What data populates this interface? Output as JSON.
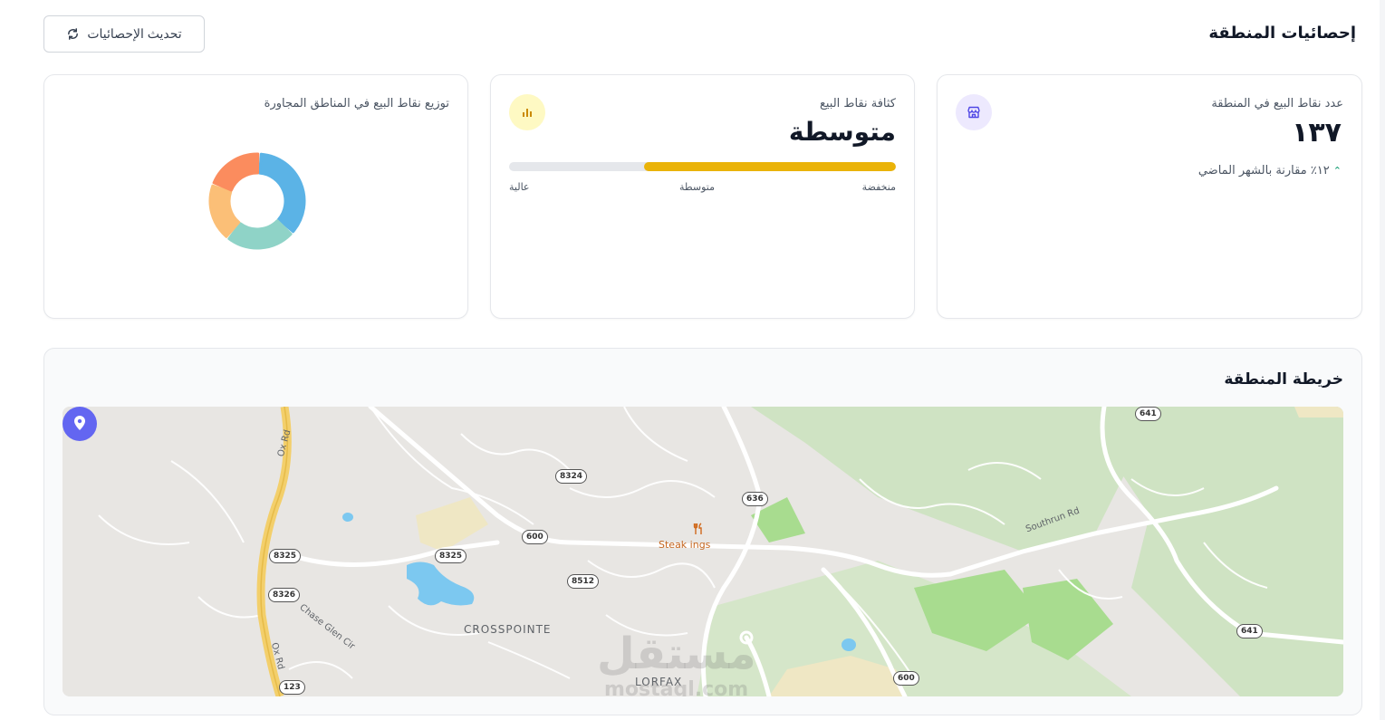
{
  "header": {
    "title": "إحصائيات المنطقة",
    "refresh_label": "تحديث الإحصائيات"
  },
  "cards": {
    "count": {
      "label": "عدد نقاط البيع في المنطقة",
      "value": "١٣٧",
      "trend_text": "١٢٪ مقارنة بالشهر الماضي",
      "trend_icon": "chevron-up-icon",
      "icon": "store-icon"
    },
    "density": {
      "label": "كثافة نقاط البيع",
      "value": "متوسطة",
      "icon": "bar-chart-icon",
      "level_fraction": 0.65,
      "scale": {
        "low": "منخفضة",
        "mid": "متوسطة",
        "high": "عالية"
      }
    },
    "distribution": {
      "label": "توزيع نقاط البيع في المناطق المجاورة",
      "segments": [
        {
          "color": "#5bb3e6",
          "share": 0.36
        },
        {
          "color": "#8fd3c7",
          "share": 0.24
        },
        {
          "color": "#fbbf77",
          "share": 0.2
        },
        {
          "color": "#fb8c5e",
          "share": 0.2
        }
      ]
    }
  },
  "map_section": {
    "title": "خريطة المنطقة",
    "place_labels": {
      "crosspointe": "CROSSPOINTE",
      "lorfax": "LORFAX",
      "restaurant": "Steak  ings",
      "chase": "Chase Glen Cir",
      "southrun": "Southrun Rd",
      "ox_top": "Ox Rd",
      "ox_bottom": "Ox Rd"
    },
    "routes": [
      "641",
      "8324",
      "636",
      "600",
      "8325",
      "8325",
      "8512",
      "8326",
      "641",
      "600",
      "123"
    ],
    "watermark": "مستقل",
    "watermark_sub": "mostaql.com"
  },
  "colors": {
    "accent": "#6366f1",
    "density_bar": "#eab308",
    "trend_green": "#059669"
  }
}
